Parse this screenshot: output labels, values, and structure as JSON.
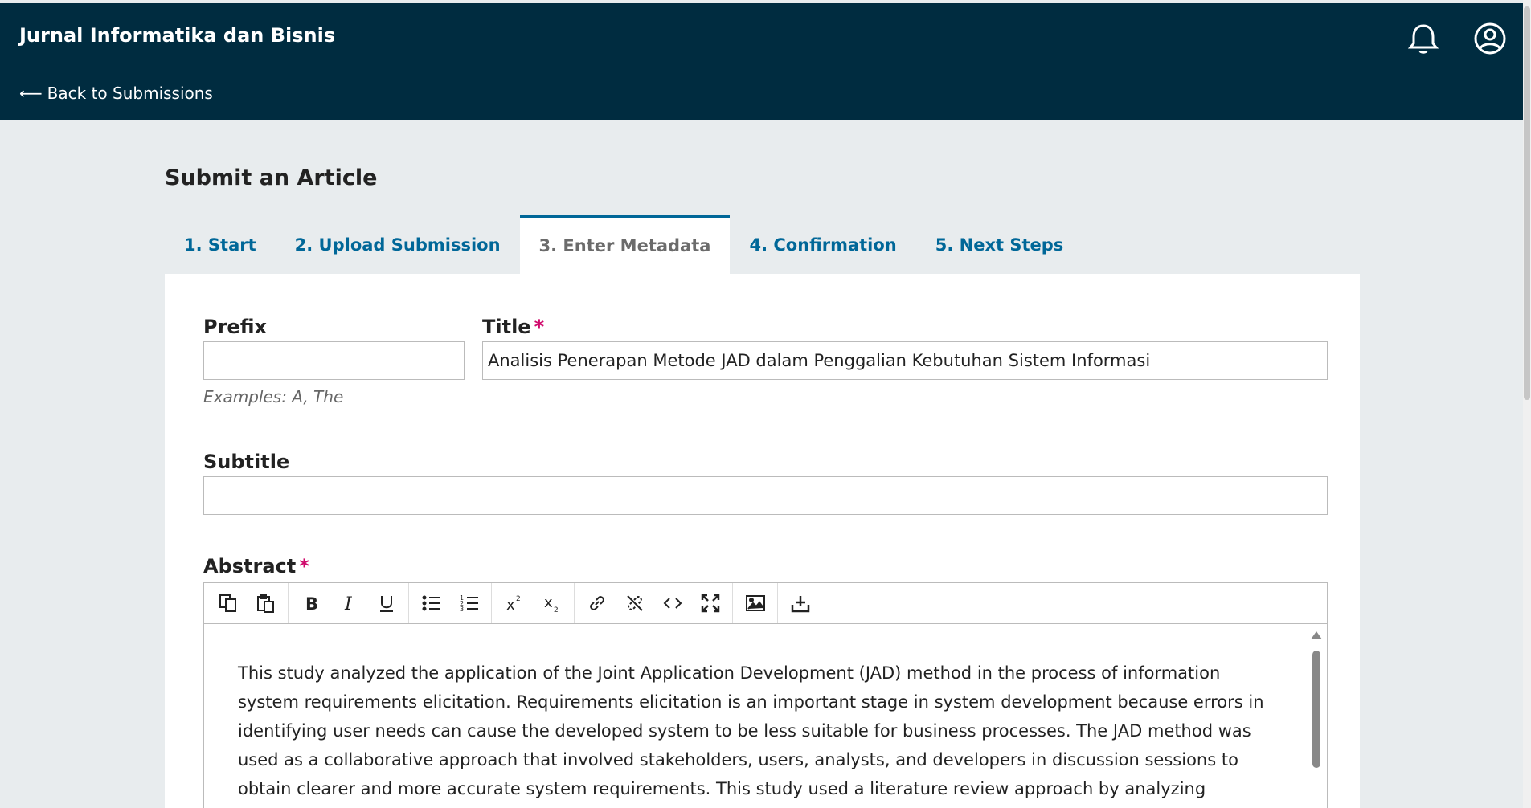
{
  "header": {
    "site_title": "Jurnal Informatika dan Bisnis",
    "back_label": "Back to Submissions",
    "back_arrow": "⟵",
    "colors": {
      "background": "#002c40",
      "text": "#ffffff"
    }
  },
  "page": {
    "title": "Submit an Article"
  },
  "tabs": [
    {
      "label": "1. Start",
      "active": false
    },
    {
      "label": "2. Upload Submission",
      "active": false
    },
    {
      "label": "3. Enter Metadata",
      "active": true
    },
    {
      "label": "4. Confirmation",
      "active": false
    },
    {
      "label": "5. Next Steps",
      "active": false
    }
  ],
  "form": {
    "prefix": {
      "label": "Prefix",
      "value": "",
      "help": "Examples: A, The"
    },
    "title": {
      "label": "Title",
      "required_mark": "*",
      "value": "Analisis Penerapan Metode JAD dalam Penggalian Kebutuhan Sistem Informasi"
    },
    "subtitle": {
      "label": "Subtitle",
      "value": ""
    },
    "abstract": {
      "label": "Abstract",
      "required_mark": "*",
      "toolbar_icons": [
        "copy-icon",
        "paste-icon",
        "bold-icon",
        "italic-icon",
        "underline-icon",
        "bullet-list-icon",
        "numbered-list-icon",
        "superscript-icon",
        "subscript-icon",
        "link-icon",
        "unlink-icon",
        "code-icon",
        "fullscreen-icon",
        "image-icon",
        "upload-icon"
      ],
      "text": "This study analyzed the application of the Joint Application Development (JAD) method in the process of information system requirements elicitation. Requirements elicitation is an important stage in system development because errors in identifying user needs can cause the developed system to be less suitable for business processes. The JAD method was used as a collaborative approach that involved stakeholders, users, analysts, and developers in discussion sessions to obtain clearer and more accurate system requirements. This study used a literature review approach by analyzing several previous studies related to the application"
    }
  },
  "colors": {
    "accent": "#006798",
    "required": "#d00a6c",
    "page_bg": "#e8ecee"
  }
}
